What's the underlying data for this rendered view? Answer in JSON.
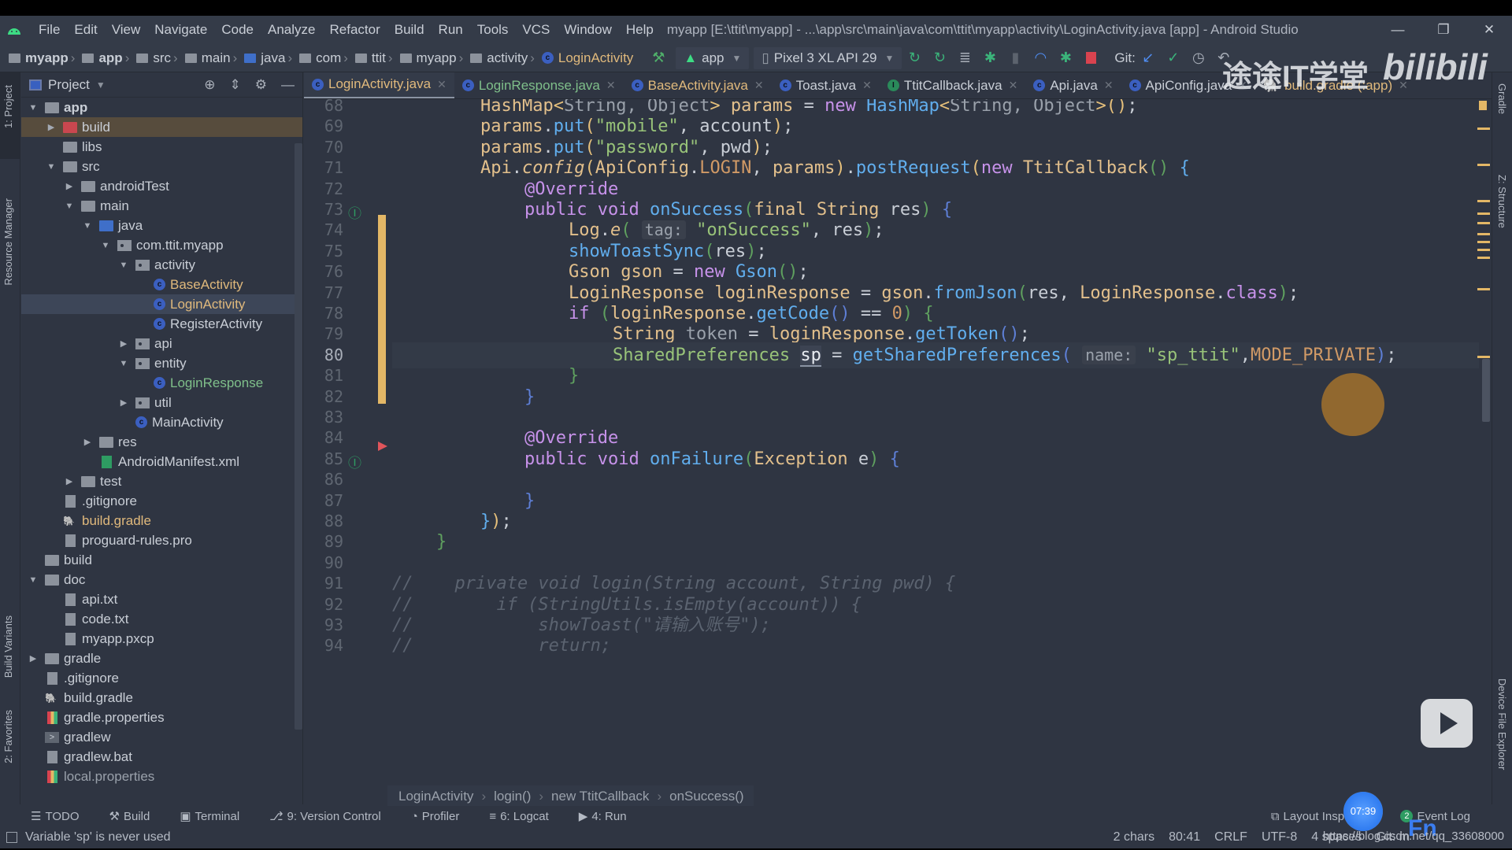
{
  "window": {
    "title": "myapp [E:\\ttit\\myapp] - ...\\app\\src\\main\\java\\com\\ttit\\myapp\\activity\\LoginActivity.java [app] - Android Studio",
    "controls": {
      "minimize": "—",
      "restore": "❐",
      "close": "✕"
    }
  },
  "menu": [
    "File",
    "Edit",
    "View",
    "Navigate",
    "Code",
    "Analyze",
    "Refactor",
    "Build",
    "Run",
    "Tools",
    "VCS",
    "Window",
    "Help"
  ],
  "nav_breadcrumb": [
    "myapp",
    "app",
    "src",
    "main",
    "java",
    "com",
    "ttit",
    "myapp",
    "activity",
    "LoginActivity"
  ],
  "toolbar": {
    "run_config": "app",
    "device": "Pixel 3 XL API 29",
    "git_label": "Git:",
    "icons": [
      "hammer-icon",
      "apply-changes-icon",
      "apply-code-changes-icon",
      "sync-icon",
      "debug-icon",
      "attach-icon",
      "profile-icon",
      "attach-debugger-icon",
      "stop-icon"
    ]
  },
  "left_stripe": [
    "1: Project",
    "Resource Manager",
    "Build Variants",
    "2: Favorites"
  ],
  "right_stripe": [
    "Gradle",
    "Z: Structure",
    "Device File Explorer"
  ],
  "project_panel": {
    "title": "Project",
    "tree": [
      {
        "label": "app",
        "depth": 1,
        "arrow": "▼",
        "icon": "module",
        "bold": true
      },
      {
        "label": "build",
        "depth": 2,
        "arrow": "▶",
        "icon": "folder-red",
        "style": "build-sel"
      },
      {
        "label": "libs",
        "depth": 2,
        "arrow": "",
        "icon": "folder"
      },
      {
        "label": "src",
        "depth": 2,
        "arrow": "▼",
        "icon": "folder"
      },
      {
        "label": "androidTest",
        "depth": 3,
        "arrow": "▶",
        "icon": "folder"
      },
      {
        "label": "main",
        "depth": 3,
        "arrow": "▼",
        "icon": "folder"
      },
      {
        "label": "java",
        "depth": 4,
        "arrow": "▼",
        "icon": "folder-blue"
      },
      {
        "label": "com.ttit.myapp",
        "depth": 5,
        "arrow": "▼",
        "icon": "package"
      },
      {
        "label": "activity",
        "depth": 6,
        "arrow": "▼",
        "icon": "package"
      },
      {
        "label": "BaseActivity",
        "depth": 7,
        "arrow": "",
        "icon": "class",
        "color": "orange"
      },
      {
        "label": "LoginActivity",
        "depth": 7,
        "arrow": "",
        "icon": "class",
        "color": "orange",
        "selected": true
      },
      {
        "label": "RegisterActivity",
        "depth": 7,
        "arrow": "",
        "icon": "class"
      },
      {
        "label": "api",
        "depth": 6,
        "arrow": "▶",
        "icon": "package"
      },
      {
        "label": "entity",
        "depth": 6,
        "arrow": "▼",
        "icon": "package"
      },
      {
        "label": "LoginResponse",
        "depth": 7,
        "arrow": "",
        "icon": "class",
        "color": "green"
      },
      {
        "label": "util",
        "depth": 6,
        "arrow": "▶",
        "icon": "package"
      },
      {
        "label": "MainActivity",
        "depth": 6,
        "arrow": "",
        "icon": "class"
      },
      {
        "label": "res",
        "depth": 4,
        "arrow": "▶",
        "icon": "folder"
      },
      {
        "label": "AndroidManifest.xml",
        "depth": 4,
        "arrow": "",
        "icon": "manifest"
      },
      {
        "label": "test",
        "depth": 3,
        "arrow": "▶",
        "icon": "folder"
      },
      {
        "label": ".gitignore",
        "depth": 2,
        "arrow": "",
        "icon": "file"
      },
      {
        "label": "build.gradle",
        "depth": 2,
        "arrow": "",
        "icon": "gradle",
        "color": "orange"
      },
      {
        "label": "proguard-rules.pro",
        "depth": 2,
        "arrow": "",
        "icon": "file"
      },
      {
        "label": "build",
        "depth": 1,
        "arrow": "",
        "icon": "folder"
      },
      {
        "label": "doc",
        "depth": 1,
        "arrow": "▼",
        "icon": "folder"
      },
      {
        "label": "api.txt",
        "depth": 2,
        "arrow": "",
        "icon": "file"
      },
      {
        "label": "code.txt",
        "depth": 2,
        "arrow": "",
        "icon": "file"
      },
      {
        "label": "myapp.pxcp",
        "depth": 2,
        "arrow": "",
        "icon": "file-unknown"
      },
      {
        "label": "gradle",
        "depth": 1,
        "arrow": "▶",
        "icon": "folder"
      },
      {
        "label": ".gitignore",
        "depth": 1,
        "arrow": "",
        "icon": "file"
      },
      {
        "label": "build.gradle",
        "depth": 1,
        "arrow": "",
        "icon": "gradle"
      },
      {
        "label": "gradle.properties",
        "depth": 1,
        "arrow": "",
        "icon": "properties"
      },
      {
        "label": "gradlew",
        "depth": 1,
        "arrow": "",
        "icon": "shell"
      },
      {
        "label": "gradlew.bat",
        "depth": 1,
        "arrow": "",
        "icon": "file"
      },
      {
        "label": "local.properties",
        "depth": 1,
        "arrow": "",
        "icon": "properties",
        "color": "gray"
      }
    ]
  },
  "tabs": [
    {
      "label": "LoginActivity.java",
      "icon": "class",
      "active": true,
      "color": "orange"
    },
    {
      "label": "LoginResponse.java",
      "icon": "class",
      "color": "green"
    },
    {
      "label": "BaseActivity.java",
      "icon": "class",
      "color": "orange"
    },
    {
      "label": "Toast.java",
      "icon": "class"
    },
    {
      "label": "TtitCallback.java",
      "icon": "interface"
    },
    {
      "label": "Api.java",
      "icon": "class"
    },
    {
      "label": "ApiConfig.java",
      "icon": "class"
    },
    {
      "label": "build.gradle (:app)",
      "icon": "gradle",
      "color": "orange"
    }
  ],
  "editor": {
    "current_line": 80,
    "lines": [
      {
        "n": 68,
        "html": "<span class='t'>HashMap</span><span class='p'>&lt;</span><span class='txt-gray'>String, Object</span><span class='p'>&gt;</span> <span class='t'>params</span> = <span class='k'>new</span> <span class='f'>HashMap</span><span class='p'>&lt;</span><span class='txt-gray'>String, Object</span><span class='p'>&gt;()</span>;",
        "indent": 2
      },
      {
        "n": 69,
        "html": "<span class='t'>params</span>.<span class='f'>put</span><span class='p'>(</span><span class='s'>\"mobile\"</span>, <span class='var'>account</span><span class='p'>)</span>;",
        "indent": 2
      },
      {
        "n": 70,
        "html": "<span class='t'>params</span>.<span class='f'>put</span><span class='p'>(</span><span class='s'>\"password\"</span>, <span class='var'>pwd</span><span class='p'>)</span>;",
        "indent": 2
      },
      {
        "n": 71,
        "html": "<span class='t'>Api</span>.<span class='t i'>config</span><span class='p'>(</span><span class='t'>ApiConfig</span>.<span class='n'>LOGIN</span>, <span class='t'>params</span><span class='p'>)</span>.<span class='f'>postRequest</span><span class='p'>(</span><span class='k'>new</span> <span class='t'>TtitCallback</span><span class='pg'>()</span> <span class='f'>{</span>",
        "indent": 2
      },
      {
        "n": 72,
        "html": "<span class='anno'>@Override</span>",
        "indent": 3
      },
      {
        "n": 73,
        "html": "<span class='k'>public void</span> <span class='f'>onSuccess</span><span class='pg'>(</span><span class='t'>final String</span> <span class='var'>res</span><span class='pg'>)</span> <span class='pb'>{</span>",
        "indent": 3,
        "impl": true
      },
      {
        "n": 74,
        "html": "<span class='t'>Log</span>.<span class='t i'>e</span><span class='pg'>(</span> <span class='hint'>tag:</span> <span class='s'>\"onSuccess\"</span>, <span class='var'>res</span><span class='pg'>)</span>;",
        "indent": 4
      },
      {
        "n": 75,
        "html": "<span class='f'>showToastSync</span><span class='pg'>(</span><span class='var'>res</span><span class='pg'>)</span>;",
        "indent": 4
      },
      {
        "n": 76,
        "html": "<span class='t'>Gson gson</span> = <span class='k'>new</span> <span class='f'>Gson</span><span class='pg'>()</span>;",
        "indent": 4
      },
      {
        "n": 77,
        "html": "<span class='t'>LoginResponse loginResponse</span> = <span class='t'>gson</span>.<span class='f'>fromJson</span><span class='pg'>(</span><span class='var'>res</span>, <span class='t'>LoginResponse</span>.<span class='k'>class</span><span class='pg'>)</span>;",
        "indent": 4
      },
      {
        "n": 78,
        "html": "<span class='k'>if</span> <span class='pg'>(</span><span class='t'>loginResponse</span>.<span class='f'>getCode</span><span class='pb'>()</span> == <span class='n'>0</span><span class='pg'>)</span> <span class='pg'>{</span>",
        "indent": 4
      },
      {
        "n": 79,
        "html": "<span class='t'>String</span> <span class='txt-gray'>token</span> = <span class='t'>loginResponse</span>.<span class='f'>getToken</span><span class='pb'>()</span>;",
        "indent": 5
      },
      {
        "n": 80,
        "html": "<span class='s'>SharedPreferences</span> <span class='sp-box'>sp</span> = <span class='f'>getSharedPreferences</span><span class='pb'>(</span> <span class='hint'>name:</span> <span class='s'>\"sp_ttit\"</span>,<span class='n'>MODE_PRIVATE</span><span class='pb'>)</span>;",
        "indent": 5
      },
      {
        "n": 81,
        "html": "<span class='pg'>}</span>",
        "indent": 4
      },
      {
        "n": 82,
        "html": "<span class='pb'>}</span>",
        "indent": 3
      },
      {
        "n": 83,
        "html": "",
        "indent": 0
      },
      {
        "n": 84,
        "html": "<span class='anno'>@Override</span>",
        "indent": 3
      },
      {
        "n": 85,
        "html": "<span class='k'>public void</span> <span class='f'>onFailure</span><span class='pg'>(</span><span class='t'>Exception</span> <span class='var'>e</span><span class='pg'>)</span> <span class='pb'>{</span>",
        "indent": 3,
        "impl": true
      },
      {
        "n": 86,
        "html": "",
        "indent": 0
      },
      {
        "n": 87,
        "html": "<span class='pb'>}</span>",
        "indent": 3
      },
      {
        "n": 88,
        "html": "<span class='f'>}</span><span class='p'>)</span>;",
        "indent": 2
      },
      {
        "n": 89,
        "html": "<span class='pg'>}</span>",
        "indent": 1
      },
      {
        "n": 90,
        "html": "",
        "indent": 0
      },
      {
        "n": 91,
        "html": "<span class='cmt'>//    private void login(String account, String pwd) {</span>",
        "indent": 0
      },
      {
        "n": 92,
        "html": "<span class='cmt'>//        if (StringUtils.isEmpty(account)) {</span>",
        "indent": 0
      },
      {
        "n": 93,
        "html": "<span class='cmt'>//            showToast(\"请输入账号\");</span>",
        "indent": 0
      },
      {
        "n": 94,
        "html": "<span class='cmt'>//            return;</span>",
        "indent": 0
      }
    ]
  },
  "editor_breadcrumb": [
    "LoginActivity",
    "login()",
    "new TtitCallback",
    "onSuccess()"
  ],
  "bottom_tools": [
    {
      "label": "TODO",
      "icon": "list-icon",
      "glyph": "☰"
    },
    {
      "label": "Build",
      "icon": "hammer-icon",
      "glyph": "⚒"
    },
    {
      "label": "Terminal",
      "icon": "terminal-icon",
      "glyph": "▣"
    },
    {
      "label": "9: Version Control",
      "icon": "version-control-icon",
      "glyph": "⎇"
    },
    {
      "label": "Profiler",
      "icon": "profiler-icon",
      "glyph": "◔"
    },
    {
      "label": "6: Logcat",
      "icon": "logcat-icon",
      "glyph": "≡"
    },
    {
      "label": "4: Run",
      "icon": "run-icon",
      "glyph": "▶"
    }
  ],
  "bottom_right_tools": [
    {
      "label": "Layout Inspector",
      "icon": "layout-inspector-icon"
    },
    {
      "label": "Event Log",
      "icon": "event-log-icon",
      "badge": "2"
    }
  ],
  "status": {
    "message": "Variable 'sp' is never used",
    "selection": "2 chars",
    "position": "80:41",
    "line_sep": "CRLF",
    "encoding": "UTF-8",
    "indent": "4 spaces",
    "git": "Git: m"
  },
  "overlay": {
    "recorder_time": "07:39",
    "watermark_cn": "途途IT学堂",
    "watermark_brand": "bilibili",
    "watermark_url": "https://blog.csdn.net/qq_33608000",
    "ime": "Fn"
  },
  "colors": {
    "accent": "#e3b766",
    "background": "#2f3542",
    "class_icon": "#3b5fc0",
    "string": "#98c379",
    "keyword": "#c792ea",
    "function": "#61aeee"
  }
}
